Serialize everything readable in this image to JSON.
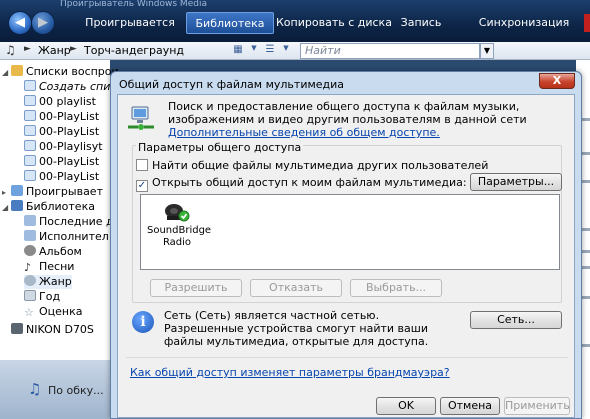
{
  "wmp": {
    "title": "Проигрыватель Windows Media",
    "tabs": [
      "Проигрывается",
      "Библиотека",
      "Копировать с диска",
      "Запись",
      "Синхронизация"
    ],
    "active_tab": "Библиотека",
    "breadcrumb": [
      "Жанр",
      "Торч-андеграунд"
    ],
    "search_placeholder": "Найти",
    "tree": [
      {
        "label": "Списки воспрои",
        "icon": "playlist-folder-icon"
      },
      {
        "label": "Создать спи",
        "icon": "playlist-icon",
        "italic": true
      },
      {
        "label": "00 playlist",
        "icon": "playlist-icon"
      },
      {
        "label": "00-PlayList",
        "icon": "playlist-icon"
      },
      {
        "label": "00-PlayList",
        "icon": "playlist-icon"
      },
      {
        "label": "00-Playlisyt",
        "icon": "playlist-icon"
      },
      {
        "label": "00-PlayList",
        "icon": "playlist-icon"
      },
      {
        "label": "00-PlayList",
        "icon": "playlist-icon"
      },
      {
        "label": "Проигрывает",
        "icon": "now-playing-icon"
      },
      {
        "label": "Библиотека",
        "icon": "library-icon"
      },
      {
        "label": "Последние д",
        "icon": "recent-icon"
      },
      {
        "label": "Исполнител",
        "icon": "artist-icon"
      },
      {
        "label": "Альбом",
        "icon": "album-icon"
      },
      {
        "label": "Песни",
        "icon": "songs-icon"
      },
      {
        "label": "Жанр",
        "icon": "genre-icon"
      },
      {
        "label": "Год",
        "icon": "year-icon"
      },
      {
        "label": "Оценка",
        "icon": "rating-icon"
      },
      {
        "label": "NIKON D70S",
        "icon": "camera-icon"
      }
    ],
    "bottom_label": "По обку..."
  },
  "dialog": {
    "title": "Общий доступ к файлам мультимедиа",
    "close_label": "X",
    "intro": "Поиск и предоставление общего доступа к файлам музыки, изображениям и видео другим пользователям в данной сети",
    "more_link": "Дополнительные сведения об общем доступе.",
    "group_label": "Параметры общего доступа",
    "find_shared_label": "Найти общие файлы мультимедиа других пользователей",
    "find_shared_checked": false,
    "share_mine_label": "Открыть общий доступ к моим файлам мультимедиа:",
    "share_mine_checked": true,
    "settings_button": "Параметры...",
    "device_name": "SoundBridge Radio",
    "allow_button": "Разрешить",
    "deny_button": "Отказать",
    "customize_button": "Выбрать...",
    "network_info": "Сеть (Сеть) является частной сетью. Разрешенные устройства смогут найти ваши файлы мультимедиа, открытые для доступа.",
    "network_button": "Сеть...",
    "firewall_link": "Как общий доступ изменяет параметры брандмауэра?",
    "ok_button": "OK",
    "cancel_button": "Отмена",
    "apply_button": "Применить"
  }
}
